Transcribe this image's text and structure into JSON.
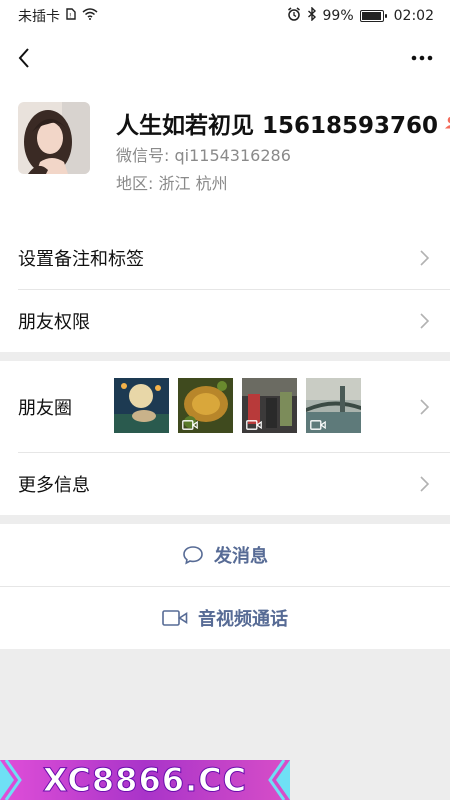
{
  "status_bar": {
    "carrier": "未插卡",
    "battery": "99%",
    "battery_level": 0.99,
    "time": "02:02"
  },
  "profile": {
    "name": "人生如若初见 15618593760",
    "wechat_id": "微信号: qi1154316286",
    "region": "地区: 浙江  杭州"
  },
  "menu": {
    "remark_tags": "设置备注和标签",
    "permissions": "朋友权限",
    "moments": "朋友圈",
    "more_info": "更多信息"
  },
  "actions": {
    "send_message": "发消息",
    "av_call": "音视频通话"
  },
  "watermark": "XC8866.CC",
  "colors": {
    "link_blue": "#576b95",
    "gender_icon": "#f36b5b",
    "watermark_bg": "#b43cc8"
  }
}
